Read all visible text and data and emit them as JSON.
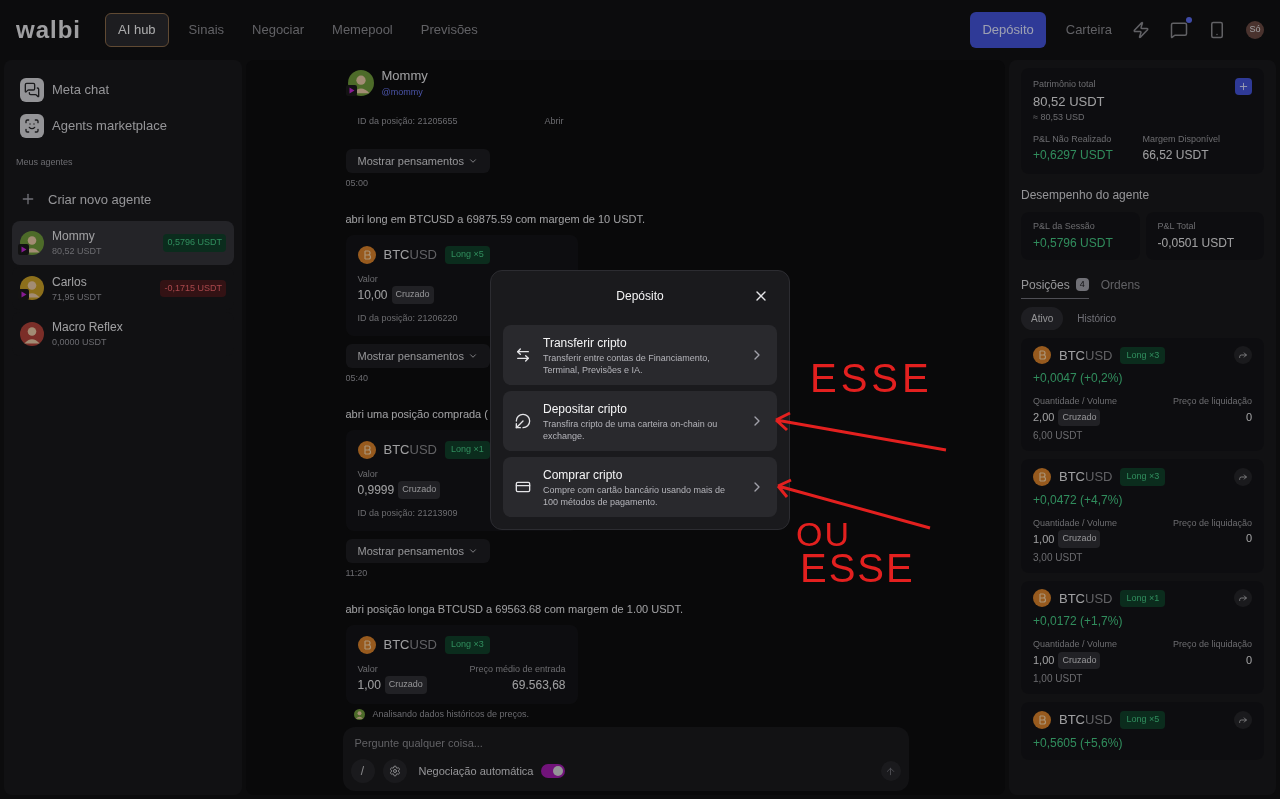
{
  "nav": {
    "logo": "walbi",
    "tabs": [
      {
        "label": "AI hub",
        "selected": true
      },
      {
        "label": "Sinais",
        "selected": false
      },
      {
        "label": "Negociar",
        "selected": false
      },
      {
        "label": "Memepool",
        "selected": false
      },
      {
        "label": "Previsões",
        "selected": false
      }
    ],
    "deposit_button": "Depósito",
    "wallet_link": "Carteira",
    "unread": true,
    "avatar": "Só"
  },
  "sidebar": {
    "links": [
      {
        "label": "Meta chat"
      },
      {
        "label": "Agents marketplace"
      }
    ],
    "section_title": "Meus agentes",
    "create_button": "Criar novo agente",
    "agents": [
      {
        "name": "Mommy",
        "balance": "80,52 USDT",
        "pnl": "0,5796 USDT",
        "gain": true,
        "selected": true,
        "live": true
      },
      {
        "name": "Carlos",
        "balance": "71,95 USDT",
        "pnl": "-0,1715 USDT",
        "gain": false,
        "selected": false,
        "live": true
      },
      {
        "name": "Macro Reflex",
        "balance": "0,0000 USDT",
        "selected": false,
        "live": false
      }
    ]
  },
  "chat": {
    "agent": {
      "name": "Mommy",
      "handle": "@mommy"
    },
    "items": [
      {
        "kind": "card_end",
        "position_id": "ID da posição: 21205655",
        "action": "Abrir"
      },
      {
        "kind": "thoughts",
        "label": "Mostrar pensamentos",
        "time": "05:00"
      },
      {
        "kind": "message",
        "text": "abri long em BTCUSD a 69875.59 com margem de 10 USDT."
      },
      {
        "kind": "position",
        "base": "BTC",
        "quote": "USD",
        "leverage": "Long ×5",
        "value_label": "Valor",
        "value": "10,00",
        "mode": "Cruzado",
        "position_id": "ID da posição: 21206220"
      },
      {
        "kind": "thoughts",
        "label": "Mostrar pensamentos",
        "time": "05:40"
      },
      {
        "kind": "message",
        "text": "abri uma posição comprada ("
      },
      {
        "kind": "position",
        "base": "BTC",
        "quote": "USD",
        "leverage": "Long ×1",
        "value_label": "Valor",
        "value": "0,9999",
        "mode": "Cruzado",
        "position_id": "ID da posição: 21213909"
      },
      {
        "kind": "thoughts",
        "label": "Mostrar pensamentos",
        "time": "11:20"
      },
      {
        "kind": "message",
        "text": "abri posição longa BTCUSD a 69563.68 com margem de 1.00 USDT."
      },
      {
        "kind": "position",
        "base": "BTC",
        "quote": "USD",
        "leverage": "Long ×3",
        "value_label": "Valor",
        "value": "1,00",
        "mode": "Cruzado",
        "entry_label": "Preço médio de entrada",
        "entry": "69.563,68"
      },
      {
        "kind": "status",
        "text": "Analisando dados históricos de preços."
      }
    ],
    "composer": {
      "placeholder": "Pergunte qualquer coisa...",
      "command": "/",
      "auto_trading": {
        "label": "Negociação automática",
        "on": true
      }
    }
  },
  "account": {
    "equity_label": "Patrimônio total",
    "equity": "80,52 USDT",
    "equity_usd": "≈ 80,53 USD",
    "unrealized_label": "P&L Não Realizado",
    "unrealized": "+0,6297 USDT",
    "margin_label": "Margem Disponível",
    "margin": "66,52 USDT"
  },
  "performance": {
    "title": "Desempenho do agente",
    "stats": [
      {
        "label": "P&L da Sessão",
        "value": "+0,5796 USDT",
        "gain": true
      },
      {
        "label": "P&L Total",
        "value": "-0,0501 USDT",
        "gain": false
      }
    ]
  },
  "position_tabs": [
    {
      "label": "Posições",
      "count": "4",
      "selected": true
    },
    {
      "label": "Ordens",
      "selected": false
    }
  ],
  "filters": [
    {
      "label": "Ativo",
      "selected": true
    },
    {
      "label": "Histórico",
      "selected": false
    }
  ],
  "positions": [
    {
      "base": "BTC",
      "quote": "USD",
      "leverage": "Long ×3",
      "pnl": "+0,0047 (+0,2%)",
      "quantity_label": "Quantidade / Volume",
      "quantity": "2,00",
      "mode": "Cruzado",
      "volume": "6,00 USDT",
      "liq_label": "Preço de liquidação",
      "liq": "0"
    },
    {
      "base": "BTC",
      "quote": "USD",
      "leverage": "Long ×3",
      "pnl": "+0,0472 (+4,7%)",
      "quantity_label": "Quantidade / Volume",
      "quantity": "1,00",
      "mode": "Cruzado",
      "volume": "3,00 USDT",
      "liq_label": "Preço de liquidação",
      "liq": "0"
    },
    {
      "base": "BTC",
      "quote": "USD",
      "leverage": "Long ×1",
      "pnl": "+0,0172 (+1,7%)",
      "quantity_label": "Quantidade / Volume",
      "quantity": "1,00",
      "mode": "Cruzado",
      "volume": "1,00 USDT",
      "liq_label": "Preço de liquidação",
      "liq": "0"
    },
    {
      "base": "BTC",
      "quote": "USD",
      "leverage": "Long ×5",
      "pnl": "+0,5605 (+5,6%)"
    }
  ],
  "modal": {
    "title": "Depósito",
    "options": [
      {
        "title": "Transferir cripto",
        "description": "Transferir entre contas de Financiamento, Terminal, Previsões e IA."
      },
      {
        "title": "Depositar cripto",
        "description": "Transfira cripto de uma carteira on-chain ou exchange."
      },
      {
        "title": "Comprar cripto",
        "description": "Compre com cartão bancário usando mais de 100 métodos de pagamento."
      }
    ]
  },
  "annotations": [
    "ESSE",
    "OU",
    "ESSE"
  ]
}
